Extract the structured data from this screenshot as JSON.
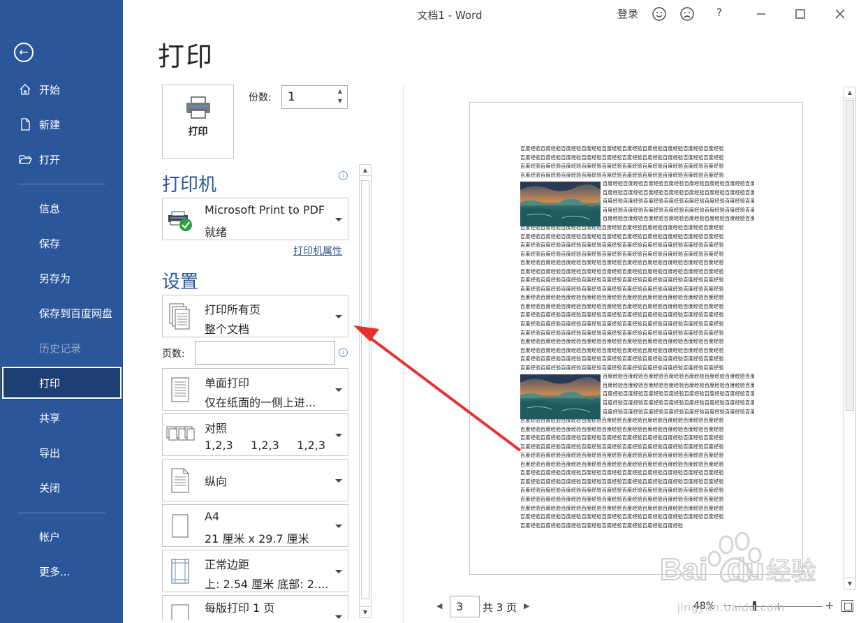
{
  "window": {
    "title": "文档1  -  Word",
    "login_label": "登录",
    "help_label": "?"
  },
  "sidebar": {
    "items": [
      {
        "label": "开始",
        "icon": "home-icon"
      },
      {
        "label": "新建",
        "icon": "new-document-icon"
      },
      {
        "label": "打开",
        "icon": "open-folder-icon"
      },
      {
        "label": "信息"
      },
      {
        "label": "保存"
      },
      {
        "label": "另存为"
      },
      {
        "label": "保存到百度网盘"
      },
      {
        "label": "历史记录",
        "disabled": true
      },
      {
        "label": "打印",
        "active": true
      },
      {
        "label": "共享"
      },
      {
        "label": "导出"
      },
      {
        "label": "关闭"
      },
      {
        "label": "帐户"
      },
      {
        "label": "更多..."
      }
    ]
  },
  "print": {
    "page_title": "打印",
    "print_button_label": "打印",
    "copies_label": "份数:",
    "copies_value": "1",
    "printer_heading": "打印机",
    "printer_name": "Microsoft Print to PDF",
    "printer_status": "就绪",
    "printer_properties_link": "打印机属性",
    "settings_heading": "设置",
    "pages_label": "页数:",
    "pages_value": "",
    "settings": [
      {
        "line1": "打印所有页",
        "line2": "整个文档",
        "icon": "pages-stack-icon"
      },
      {
        "line1": "单面打印",
        "line2": "仅在纸面的一侧上进...",
        "icon": "one-sided-icon"
      },
      {
        "line1": "对照",
        "line2": "1,2,3     1,2,3     1,2,3",
        "icon": "collate-icon"
      },
      {
        "line1": "纵向",
        "line2": "",
        "icon": "portrait-icon"
      },
      {
        "line1": "A4",
        "line2": "21 厘米 x 29.7 厘米",
        "icon": "paper-size-icon"
      },
      {
        "line1": "正常边距",
        "line2": "上: 2.54 厘米 底部: 2....",
        "icon": "margins-icon"
      },
      {
        "line1": "每版打印 1 页",
        "line2": "",
        "icon": "pages-per-sheet-icon"
      }
    ]
  },
  "preview": {
    "text_unit": "百度经验",
    "trailing_text": "百度经验百度经验百度经验百度经验百度经验百度经验百度经验百度经验",
    "current_page": "3",
    "total_pages": "共 3 页",
    "zoom_level": "48%",
    "zoom_fraction": 0.48
  },
  "watermark": {
    "brand": "Baidu经验",
    "url": "jingyan.baidu.com"
  },
  "colors": {
    "sidebar_bg": "#2b579a",
    "sidebar_active_bg": "#1e3f73",
    "heading_blue": "#2b579a",
    "annotation_red": "#e8302f"
  }
}
